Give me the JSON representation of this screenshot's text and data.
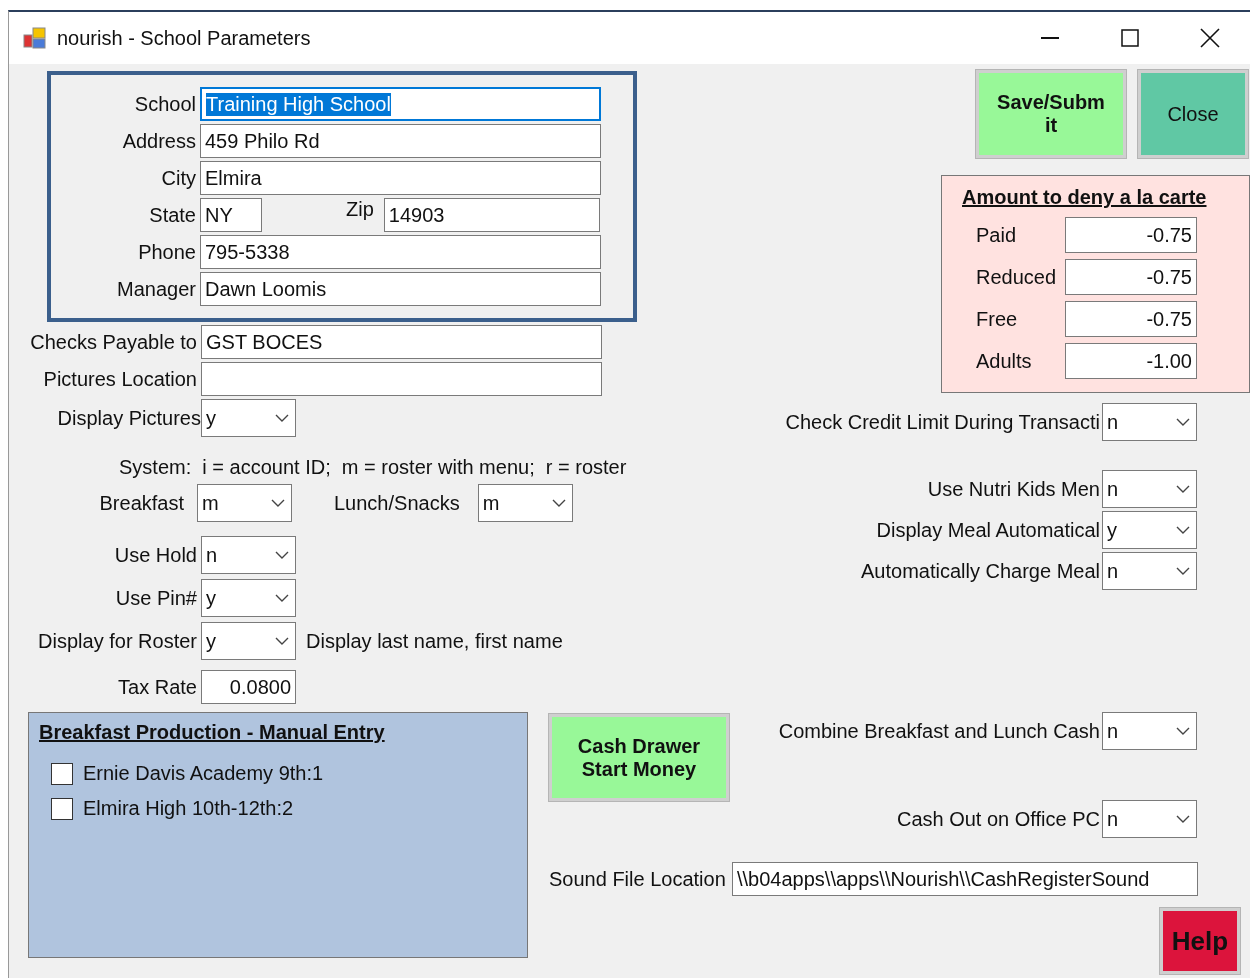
{
  "window": {
    "title": "nourish - School Parameters"
  },
  "school_info": [
    {
      "kind": "field",
      "label": "School",
      "value": "Training High School",
      "highlighted": true
    },
    {
      "kind": "field",
      "label": "Address",
      "value": "459 Philo Rd",
      "highlighted": false
    },
    {
      "kind": "field",
      "label": "City",
      "value": "Elmira",
      "highlighted": false
    },
    {
      "kind": "pair",
      "label": "State",
      "value": "NY",
      "label_2": "Zip",
      "value_2": "14903",
      "highlighted": false
    },
    {
      "kind": "field",
      "label": "Phone",
      "value": "795-5338",
      "highlighted": false
    },
    {
      "kind": "field",
      "label": "Manager",
      "value": "Dawn Loomis",
      "highlighted": false
    }
  ],
  "other_fields": [
    {
      "label": "Checks Payable to",
      "value": "GST BOCES"
    },
    {
      "label": "Pictures Location"
    }
  ],
  "display_pictures": {
    "label": "Display Pictures",
    "value": "y"
  },
  "system_note": "System:  i = account ID;  m = roster with menu;  r = roster",
  "meal_systems": [
    {
      "label": "Breakfast",
      "value": "m"
    },
    {
      "label": "Lunch/Snacks",
      "value": "m"
    }
  ],
  "left_options": [
    {
      "label": "Use Hold",
      "value": "n"
    },
    {
      "label": "Use Pin#",
      "value": "y"
    },
    {
      "label": "Display for Roster",
      "value": "y",
      "note": "Display last name, first name"
    }
  ],
  "tax_rate": {
    "label": "Tax Rate",
    "value": "0.0800"
  },
  "top_buttons": [
    {
      "kind": "save",
      "label": "Save/Submit"
    },
    {
      "kind": "close",
      "label": "Close"
    }
  ],
  "deny_panel": {
    "title": "Amount to deny a la carte",
    "rows": [
      {
        "label": "Paid",
        "value": "-0.75"
      },
      {
        "label": "Reduced",
        "value": "-0.75"
      },
      {
        "label": "Free",
        "value": "-0.75"
      },
      {
        "label": "Adults",
        "value": "-1.00"
      }
    ]
  },
  "right_options": [
    {
      "label": "Check Credit Limit During Transacti",
      "value": "n"
    },
    {
      "label": "Use Nutri Kids Men",
      "value": "n"
    },
    {
      "label": "Display Meal Automatical",
      "value": "y"
    },
    {
      "label": "Automatically Charge Meal",
      "value": "n"
    }
  ],
  "production_panel": {
    "title": "Breakfast Production - Manual Entry",
    "items": [
      {
        "label": "Ernie Davis Academy 9th:1",
        "checked": false
      },
      {
        "label": "Elmira High 10th-12th:2",
        "checked": false
      }
    ]
  },
  "cash_drawer_button": "Cash Drawer Start Money",
  "bottom_options": [
    {
      "label": "Combine Breakfast and Lunch Cash",
      "value": "n"
    },
    {
      "label": "Cash Out on Office PC",
      "value": "n"
    }
  ],
  "sound_file": {
    "label": "Sound File Location",
    "value": "\\\\b04apps\\\\apps\\\\Nourish\\\\CashRegisterSound"
  },
  "help_button": "Help"
}
